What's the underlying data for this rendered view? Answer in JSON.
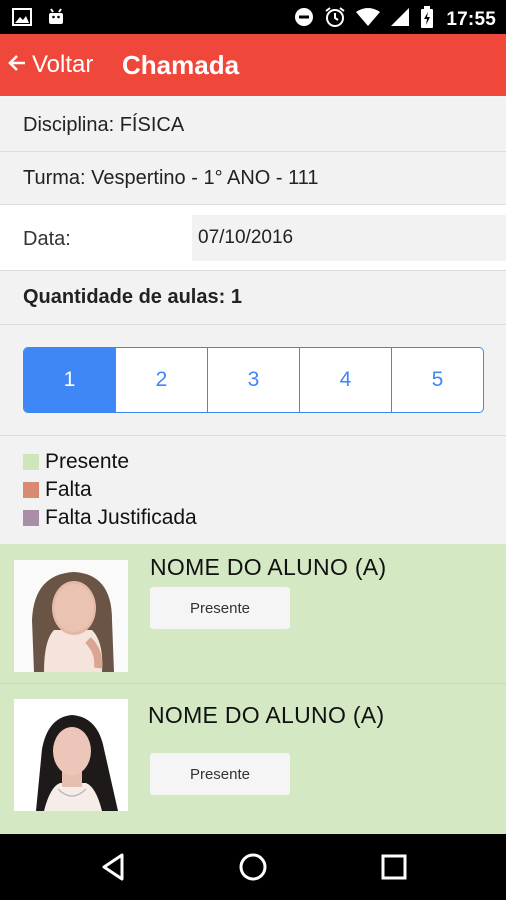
{
  "status_bar": {
    "time": "17:55",
    "left_icons": [
      "image-icon",
      "android-icon"
    ],
    "right_icons": [
      "minus-circle-icon",
      "alarm-icon",
      "wifi-icon",
      "signal-icon",
      "battery-icon"
    ]
  },
  "app_bar": {
    "back_label": "Voltar",
    "title": "Chamada",
    "color": "#f0473b"
  },
  "info": {
    "disciplina": "Disciplina: FÍSICA",
    "turma": "Turma: Vespertino - 1° ANO - 111",
    "data_label": "Data:",
    "data_value": "07/10/2016",
    "quantidade": "Quantidade de aulas: 1"
  },
  "lessons": {
    "options": [
      "1",
      "2",
      "3",
      "4",
      "5"
    ],
    "selected": "1",
    "accent": "#3f86f7"
  },
  "legend": [
    {
      "label": "Presente",
      "color": "#cfe6bd"
    },
    {
      "label": "Falta",
      "color": "#d98a72"
    },
    {
      "label": "Falta Justificada",
      "color": "#a98ea8"
    }
  ],
  "students": [
    {
      "name": "NOME DO ALUNO (A)",
      "status": "Presente"
    },
    {
      "name": "NOME DO ALUNO (A)",
      "status": "Presente"
    }
  ],
  "nav": [
    "back-icon",
    "home-icon",
    "recents-icon"
  ]
}
